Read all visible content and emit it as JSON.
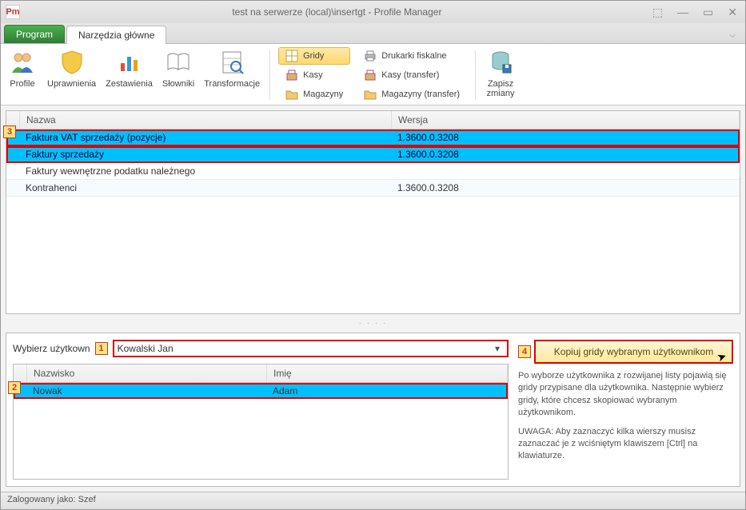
{
  "window": {
    "title": "test na serwerze (local)\\insertgt - Profile Manager",
    "app_icon_text": "Pm"
  },
  "tabs": {
    "program": "Program",
    "main": "Narzędzia główne"
  },
  "ribbon": {
    "big": [
      {
        "label": "Profile"
      },
      {
        "label": "Uprawnienia"
      },
      {
        "label": "Zestawienia"
      },
      {
        "label": "Słowniki"
      },
      {
        "label": "Transformacje"
      }
    ],
    "col1": [
      {
        "label": "Gridy",
        "selected": true
      },
      {
        "label": "Kasy"
      },
      {
        "label": "Magazyny"
      }
    ],
    "col2": [
      {
        "label": "Drukarki fiskalne"
      },
      {
        "label": "Kasy (transfer)"
      },
      {
        "label": "Magazyny (transfer)"
      }
    ],
    "save": "Zapisz\nzmiany"
  },
  "grid": {
    "headers": {
      "name": "Nazwa",
      "version": "Wersja"
    },
    "rows": [
      {
        "name": "Faktura VAT sprzedaży (pozycje)",
        "version": "1.3600.0.3208",
        "selected": true
      },
      {
        "name": "Faktury sprzedaży",
        "version": "1.3600.0.3208",
        "selected": true
      },
      {
        "name": "Faktury wewnętrzne podatku należnego",
        "version": "",
        "selected": false
      },
      {
        "name": "Kontrahenci",
        "version": "1.3600.0.3208",
        "selected": false
      }
    ]
  },
  "bottom": {
    "user_label": "Wybierz użytkown",
    "user_value": "Kowalski Jan",
    "small_headers": {
      "surname": "Nazwisko",
      "name": "Imię"
    },
    "small_rows": [
      {
        "surname": "Nowak",
        "name": "Adam",
        "selected": true
      }
    ],
    "copy_button": "Kopiuj gridy wybranym użytkownikom",
    "help1": "Po wyborze użytkownika z rozwijanej listy pojawią się gridy przypisane dla użytkownika. Następnie wybierz gridy, które chcesz skopiować wybranym użytkownikom.",
    "help2": "UWAGA: Aby zaznaczyć kilka wierszy musisz zaznaczać je z wciśniętym klawiszem [Ctrl] na klawiaturze."
  },
  "status": "Zalogowany jako: Szef",
  "badges": {
    "b1": "1",
    "b2": "2",
    "b3": "3",
    "b4": "4"
  }
}
